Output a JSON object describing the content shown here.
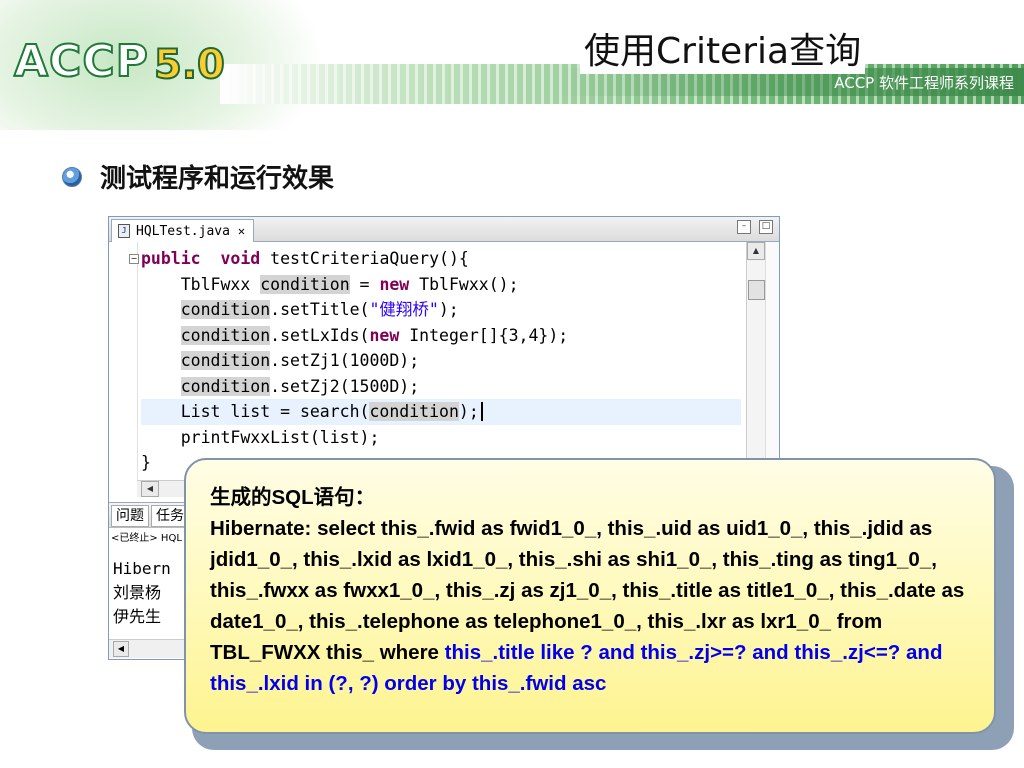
{
  "slide": {
    "logo_text": "ACCP",
    "logo_version": "5.0",
    "title": "使用Criteria查询",
    "subtitle": "ACCP 软件工程师系列课程",
    "bullet": "测试程序和运行效果"
  },
  "ide": {
    "tab_label": "HQLTest.java",
    "tab_close": "✕",
    "code_lines": [
      {
        "parts": [
          [
            "kw",
            "public"
          ],
          [
            "",
            "  "
          ],
          [
            "kw",
            "void"
          ],
          [
            "",
            " testCriteriaQuery(){"
          ]
        ]
      },
      {
        "parts": [
          [
            "",
            "    TblFwxx "
          ],
          [
            "occ",
            "condition"
          ],
          [
            "",
            " = "
          ],
          [
            "kw",
            "new"
          ],
          [
            "",
            " TblFwxx();"
          ]
        ]
      },
      {
        "parts": [
          [
            "",
            "    "
          ],
          [
            "occ",
            "condition"
          ],
          [
            "",
            ".setTitle("
          ],
          [
            "str",
            "\"健翔桥\""
          ],
          [
            "",
            ");"
          ]
        ]
      },
      {
        "parts": [
          [
            "",
            "    "
          ],
          [
            "occ",
            "condition"
          ],
          [
            "",
            ".setLxIds("
          ],
          [
            "kw",
            "new"
          ],
          [
            "",
            " Integer[]{3,4});"
          ]
        ]
      },
      {
        "parts": [
          [
            "",
            "    "
          ],
          [
            "occ",
            "condition"
          ],
          [
            "",
            ".setZj1(1000D);"
          ]
        ]
      },
      {
        "parts": [
          [
            "",
            "    "
          ],
          [
            "occ",
            "condition"
          ],
          [
            "",
            ".setZj2(1500D);"
          ]
        ]
      },
      {
        "parts": [
          [
            "",
            "    List list = search("
          ],
          [
            "occ",
            "condition"
          ],
          [
            "",
            ");"
          ]
        ],
        "current": true
      },
      {
        "parts": [
          [
            "",
            "    printFwxxList(list);"
          ]
        ]
      },
      {
        "parts": [
          [
            "",
            "}"
          ]
        ]
      }
    ],
    "console_tabs": [
      "问题",
      "任务"
    ],
    "console_status": "<已终止> HQL",
    "console_lines": [
      "Hibern",
      "刘景杨",
      "伊先生"
    ]
  },
  "callout": {
    "heading": "生成的SQL语句：",
    "sql_black": "Hibernate: select this_.fwid as fwid1_0_, this_.uid as uid1_0_, this_.jdid as jdid1_0_, this_.lxid as lxid1_0_, this_.shi as shi1_0_, this_.ting as ting1_0_, this_.fwxx as fwxx1_0_, this_.zj as zj1_0_, this_.title as title1_0_, this_.date as date1_0_, this_.telephone as telephone1_0_, this_.lxr as lxr1_0_ from TBL_FWXX this_ where ",
    "sql_blue": "this_.title like ? and this_.zj>=? and this_.zj<=? and this_.lxid in (?, ?) order by this_.fwid asc"
  },
  "colors": {
    "keyword": "#7f0055",
    "string": "#2a00ff",
    "callout_bg": "#fff9b8",
    "sql_highlight": "#0000ee",
    "logo_green": "#1f7a3a"
  }
}
